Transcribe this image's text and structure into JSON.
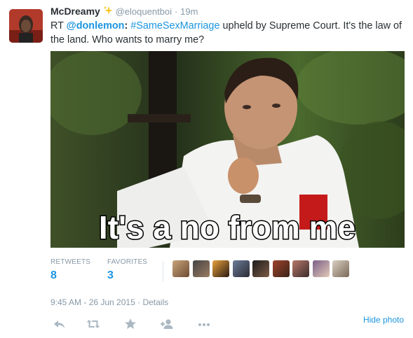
{
  "tweet": {
    "display_name": "McDreamy",
    "handle": "@eloquentboi",
    "separator": "·",
    "time_ago": "19m",
    "text": {
      "rt_prefix": "RT ",
      "mention": "@donlemon",
      "colon": ":",
      "hashtag": "#SameSexMarriage",
      "body": " upheld by  Supreme Court. It's the law of the land. Who wants to marry me?"
    },
    "photo": {
      "caption": "It's a no from me"
    },
    "stats": {
      "retweets_label": "RETWEETS",
      "retweets_count": "8",
      "favorites_label": "FAVORITES",
      "favorites_count": "3",
      "favoriter_avatars": 9
    },
    "timestamp": "9:45 AM - 26 Jun 2015",
    "timestamp_separator": "·",
    "details_link": "Details",
    "hide_photo_link": "Hide photo",
    "actions": [
      "reply-icon",
      "retweet-icon",
      "favorite-icon",
      "follow-icon",
      "more-icon"
    ],
    "colors": {
      "link": "#1b95e0",
      "muted": "#8899a6",
      "text": "#292f33",
      "action_icon": "#aab8c2"
    }
  }
}
